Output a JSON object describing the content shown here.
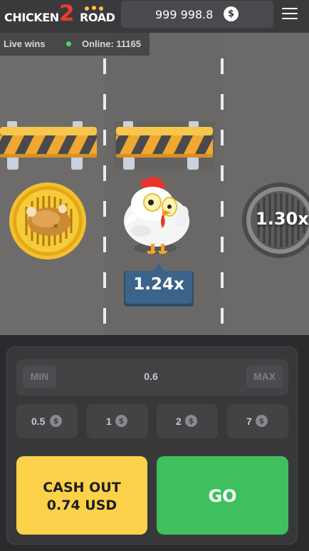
{
  "header": {
    "logo_left": "CHICKEN",
    "logo_number": "2",
    "logo_right": "ROAD",
    "balance": "999 998.8",
    "currency_symbol": "$",
    "menu_icon": "hamburger-menu-icon"
  },
  "live_bar": {
    "live_wins_label": "Live wins",
    "online_text": "Online: 11165",
    "online_color": "#4cd964"
  },
  "road": {
    "current_multiplier": "1.24x",
    "next_multiplier": "1.30x",
    "coin_icon": "roast-chicken-coin-icon",
    "barrier_icon": "road-barrier-icon",
    "manhole_icon": "manhole-cover-icon",
    "character_icon": "chicken-icon"
  },
  "controls": {
    "min_label": "MIN",
    "max_label": "MAX",
    "bet_value": "0.6",
    "chips": [
      {
        "label": "0.5",
        "coin": "$"
      },
      {
        "label": "1",
        "coin": "$"
      },
      {
        "label": "2",
        "coin": "$"
      },
      {
        "label": "7",
        "coin": "$"
      }
    ],
    "cashout_line1": "CASH OUT",
    "cashout_line2": "0.74 USD",
    "go_label": "GO"
  },
  "colors": {
    "cashout": "#fbd24a",
    "go": "#3ec05c",
    "road": "#6c6a69",
    "panel": "#38383b"
  }
}
